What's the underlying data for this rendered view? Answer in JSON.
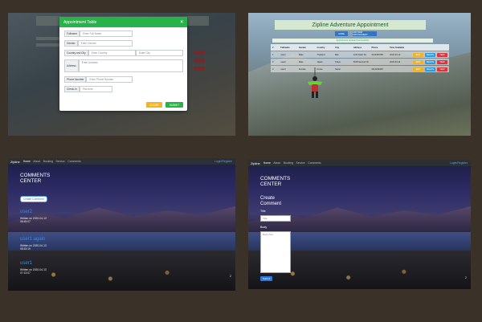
{
  "pane1": {
    "modal_title": "Appointment Table",
    "close": "×",
    "fields": [
      {
        "label": "Fullname",
        "placeholder": "Enter Full Name"
      },
      {
        "label": "Gender",
        "placeholder": "Enter Gender"
      },
      {
        "label": "Country and City",
        "placeholder": "Enter Country",
        "placeholder2": "Enter City"
      },
      {
        "label": "Address",
        "placeholder": "Enter Address"
      },
      {
        "label": "Phone Number",
        "placeholder": "Enter Phone Number"
      },
      {
        "label": "Check-In",
        "placeholder": "Pick time"
      }
    ],
    "clear_label": "CLEAR",
    "submit_label": "SUBMIT"
  },
  "pane2": {
    "title": "Zipline Adventure Appointment",
    "btn_home": "HOME",
    "btn_add": "ADD NEW APPOINTMENT",
    "message": "Appointment Updated Successfully!",
    "headers": [
      "#",
      "Fullname",
      "Gender",
      "Country",
      "City",
      "Address",
      "Phone",
      "Time Available",
      "",
      "",
      ""
    ],
    "rows": [
      [
        "1",
        "user1",
        "Male",
        "Thailand",
        "Bkk",
        "1234 Main Str.",
        "0123456789",
        "2020-04-13",
        "EDIT",
        "DELETE",
        "VIEW"
      ],
      [
        "2",
        "user2",
        "Male",
        "Japan",
        "Tokyo",
        "5678 Second Str",
        "",
        "2020-04-14",
        "EDIT",
        "DELETE",
        "VIEW"
      ],
      [
        "3",
        "user3",
        "Female",
        "Korea",
        "Seoul",
        "",
        "0112233445",
        "",
        "EDIT",
        "DELETE",
        "VIEW"
      ]
    ]
  },
  "nav": {
    "brand": "Zipline",
    "items": [
      "Home",
      "About",
      "Booking",
      "Service",
      "Comments"
    ],
    "login": "Login/Register"
  },
  "pane3": {
    "title_line1": "COMMENTS",
    "title_line2": "CENTER",
    "create_btn": "Create Comment",
    "comments": [
      {
        "user": "user2",
        "date": "Written on 2020-04-13",
        "time": "08:45:07"
      },
      {
        "user": "user1 again",
        "date": "Written on 2020-04-13",
        "time": "08:15:19"
      },
      {
        "user": "user1",
        "date": "Written on 2020-04-13",
        "time": "07:13:07"
      }
    ],
    "page": "2"
  },
  "pane4": {
    "title_line1": "COMMENTS",
    "title_line2": "CENTER",
    "form_heading1": "Create",
    "form_heading2": "Comment",
    "title_label": "Title",
    "title_placeholder": "Title",
    "body_label": "Body",
    "body_placeholder": "Body Text",
    "submit": "Submit",
    "page": "2"
  },
  "colors": {
    "green": "#28b34a",
    "blue": "#2f76c7",
    "red": "#cc3333",
    "yellow": "#f0b429"
  }
}
